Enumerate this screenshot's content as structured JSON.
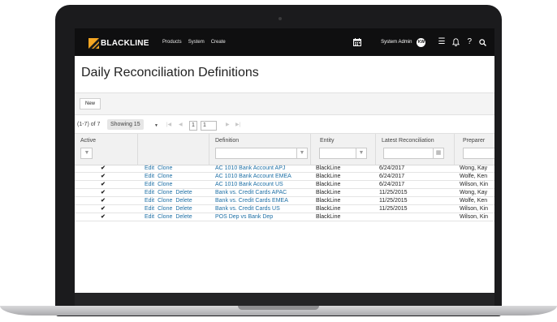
{
  "header": {
    "brand": "BLACKLINE",
    "nav": [
      "Products",
      "System",
      "Create"
    ],
    "user_name": "System Admin",
    "user_initials": "KW"
  },
  "page": {
    "title": "Daily Reconciliation Definitions",
    "new_button": "New"
  },
  "pager": {
    "count": "(1-7) of 7",
    "showing": "Showing 15",
    "page_input": "1",
    "page_total": "1"
  },
  "table": {
    "columns": {
      "active": "Active",
      "definition": "Definition",
      "entity": "Entity",
      "latest": "Latest Reconciliation",
      "preparer": "Preparer"
    },
    "action_labels": {
      "edit": "Edit",
      "clone": "Clone",
      "delete": "Delete"
    },
    "rows": [
      {
        "definition": "AC 1010 Bank Account APJ",
        "entity": "BlackLine",
        "latest": "6/24/2017",
        "preparer": "Wong, Kay"
      },
      {
        "definition": "AC 1010 Bank Account EMEA",
        "entity": "BlackLine",
        "latest": "6/24/2017",
        "preparer": "Wolfe, Ken"
      },
      {
        "definition": "AC 1010 Bank Account US",
        "entity": "BlackLine",
        "latest": "6/24/2017",
        "preparer": "Wilson, Kin"
      },
      {
        "definition": "Bank vs. Credit Cards APAC",
        "entity": "BlackLine",
        "latest": "11/25/2015",
        "preparer": "Wong, Kay"
      },
      {
        "definition": "Bank vs. Credit Cards EMEA",
        "entity": "BlackLine",
        "latest": "11/25/2015",
        "preparer": "Wolfe, Ken"
      },
      {
        "definition": "Bank vs. Credit Cards US",
        "entity": "BlackLine",
        "latest": "11/25/2015",
        "preparer": "Wilson, Kin"
      },
      {
        "definition": "POS Dep vs Bank Dep",
        "entity": "BlackLine",
        "latest": "",
        "preparer": "Wilson, Kin"
      }
    ]
  },
  "colors": {
    "link": "#1d6fa5",
    "topbar": "#0f0f10",
    "logo": "#f5a623"
  }
}
